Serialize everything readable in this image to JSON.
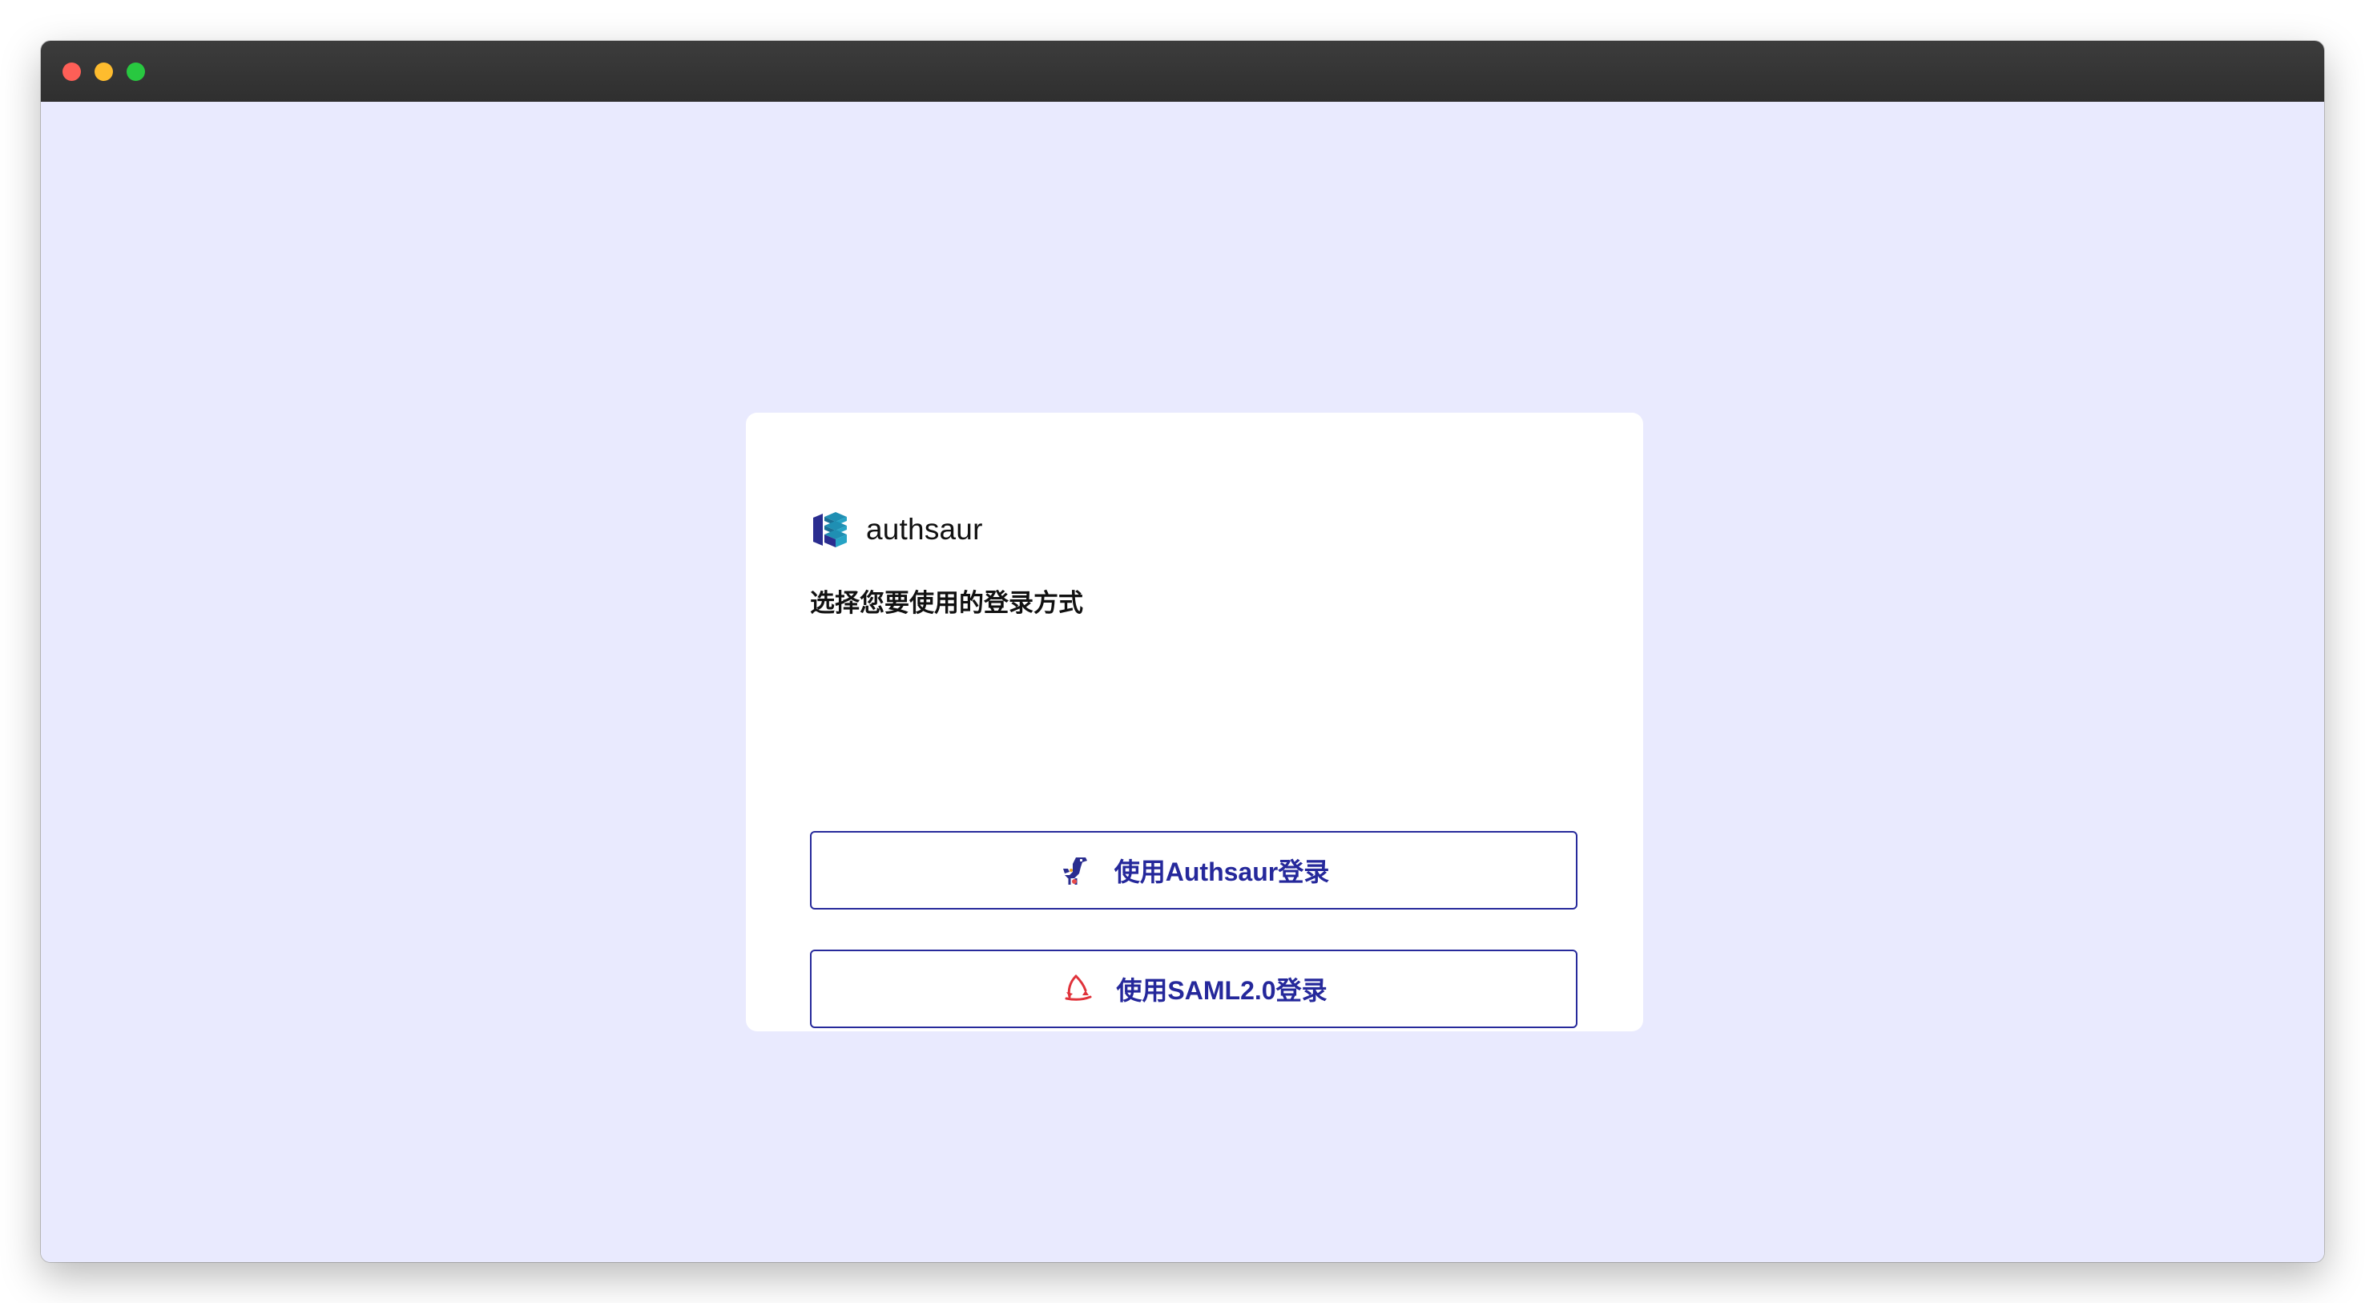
{
  "brand": {
    "name": "authsaur",
    "logo_icon": "authsaur-logo-icon",
    "colors": {
      "dark": "#2a2d8f",
      "teal": "#1f8fb3"
    }
  },
  "login": {
    "heading": "选择您要使用的登录方式",
    "options": [
      {
        "label": "使用Authsaur登录",
        "icon": "dinosaur-icon"
      },
      {
        "label": "使用SAML2.0登录",
        "icon": "saml-icon"
      }
    ]
  },
  "theme": {
    "page_background": "#e9eafe",
    "card_background": "#ffffff",
    "button_border": "#272a9b",
    "button_text": "#25289b"
  }
}
